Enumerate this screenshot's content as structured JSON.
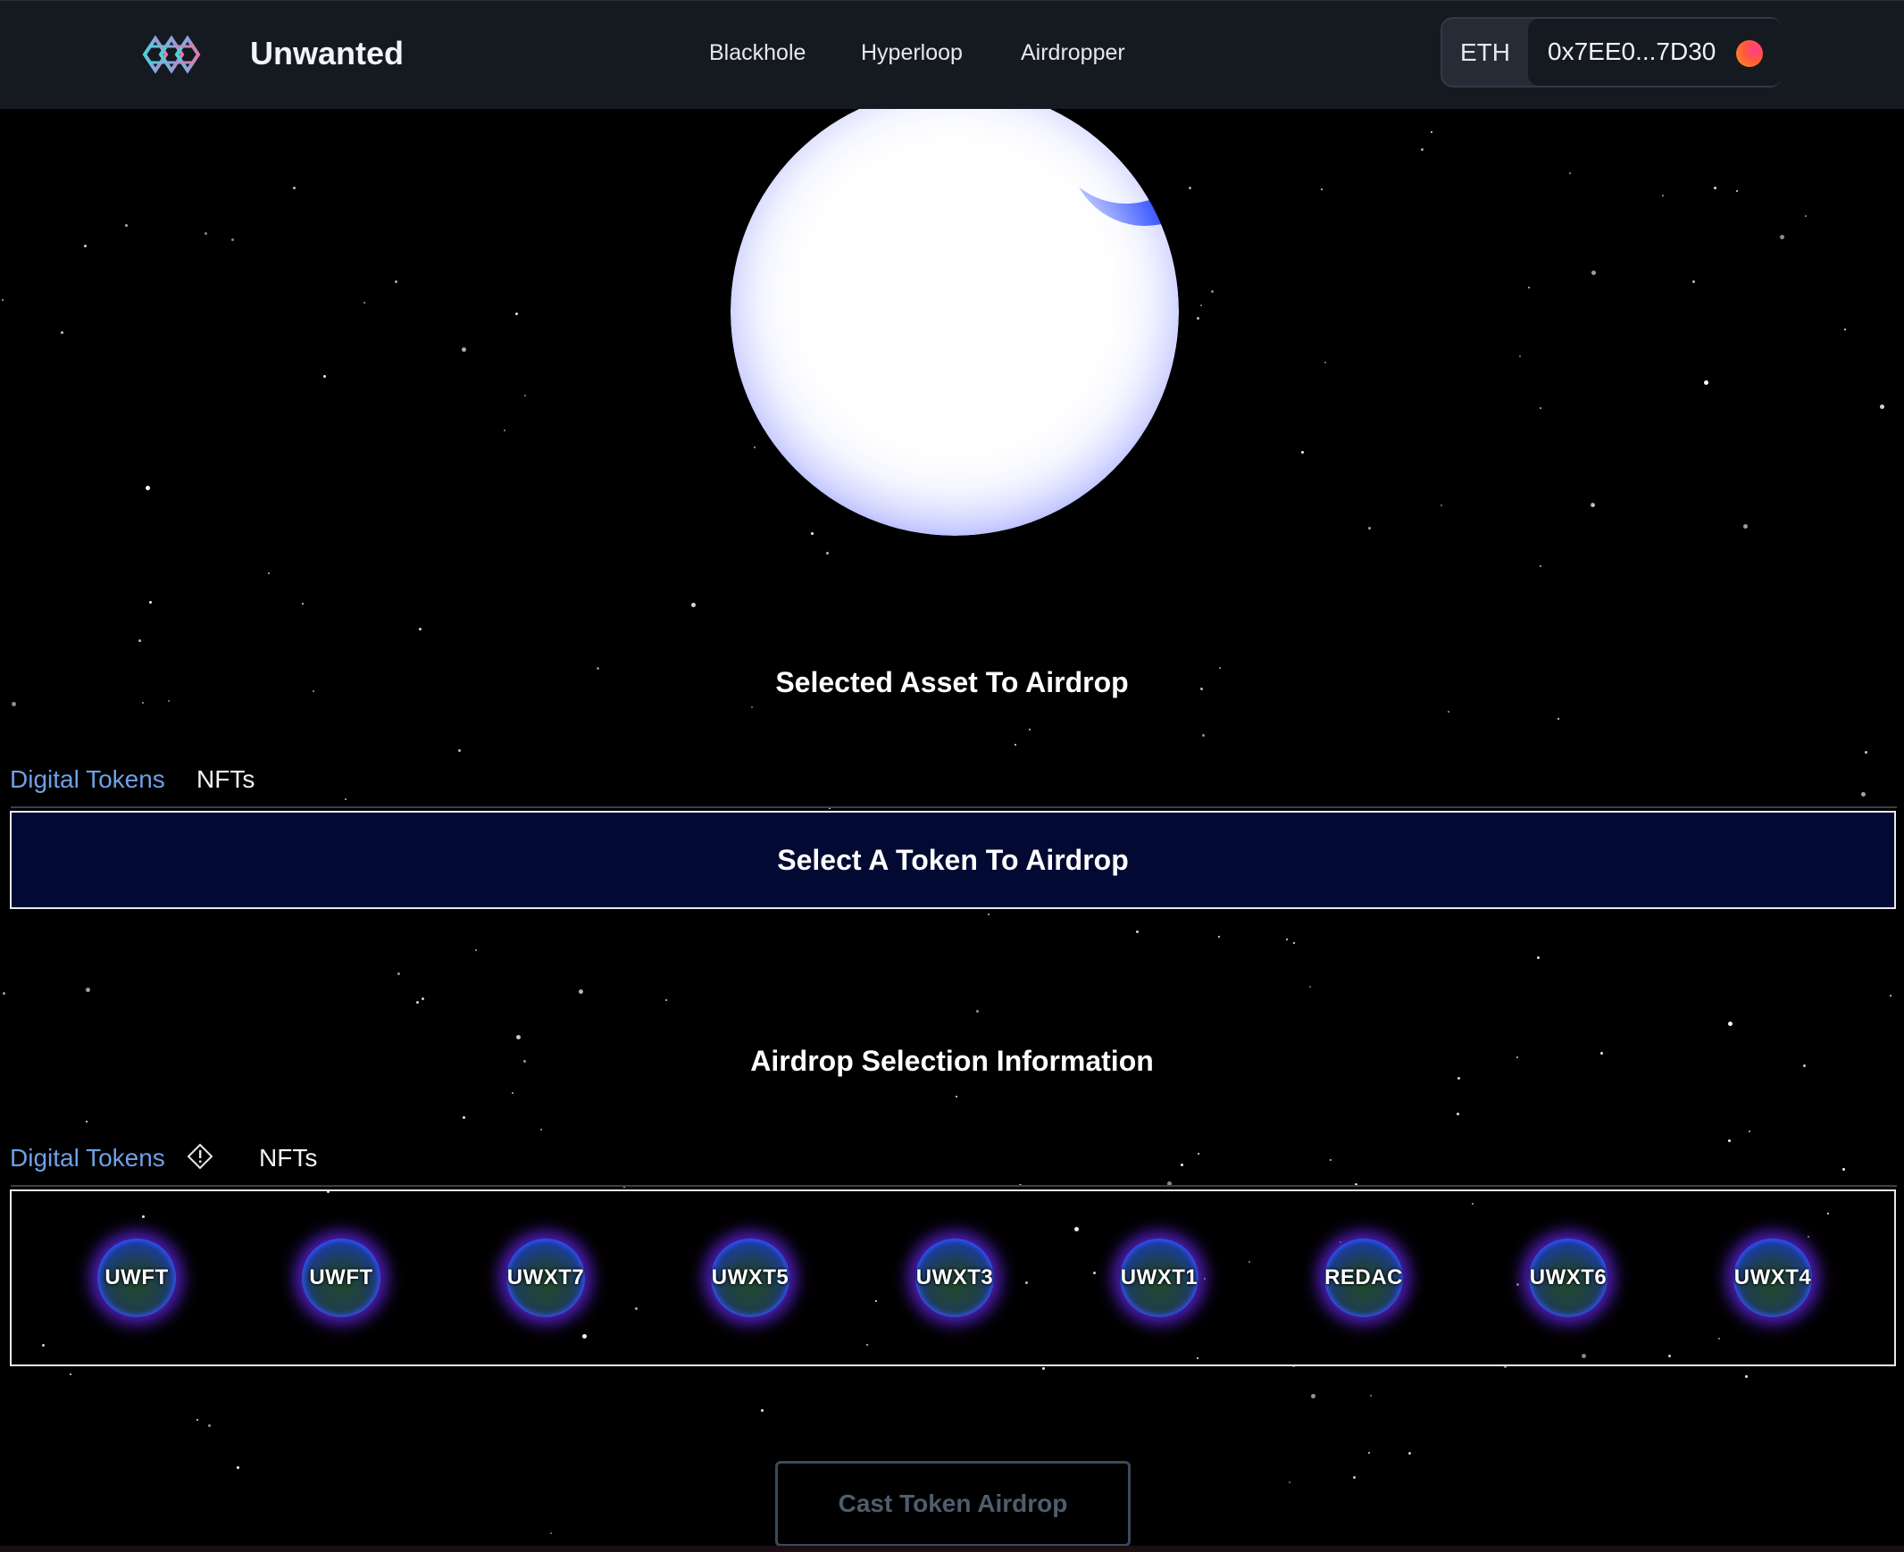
{
  "header": {
    "brand": "Unwanted",
    "nav": [
      "Blackhole",
      "Hyperloop",
      "Airdropper"
    ],
    "network": "ETH",
    "address": "0x7EE0...7D30"
  },
  "selected": {
    "title": "Selected Asset To Airdrop",
    "tabs": [
      "Digital Tokens",
      "NFTs"
    ],
    "select_label": "Select A Token To Airdrop"
  },
  "info": {
    "title": "Airdrop Selection Information",
    "tabs": [
      "Digital Tokens",
      "NFTs"
    ],
    "tokens": [
      "UWFT",
      "UWFT",
      "UWXT7",
      "UWXT5",
      "UWXT3",
      "UWXT1",
      "REDAC",
      "UWXT6",
      "UWXT4"
    ]
  },
  "actions": {
    "cast_label": "Cast Token Airdrop"
  },
  "colors": {
    "accent_tab": "#6ea0e6",
    "header_bg": "#151920",
    "select_bg": "#020a33",
    "token_glow": "#6e28ff"
  }
}
